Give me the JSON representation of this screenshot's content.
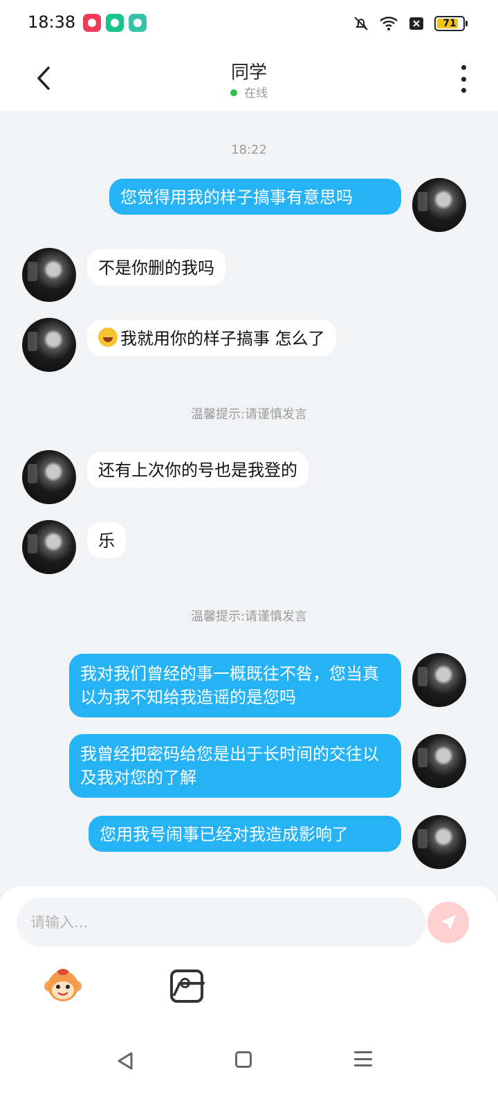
{
  "status_bar": {
    "time": "18:38",
    "battery": "71"
  },
  "header": {
    "title": "同学",
    "status": "在线"
  },
  "chat": {
    "timestamp": "18:22",
    "notice_1": "温馨提示:请谨慎发言",
    "notice_2": "温馨提示:请谨慎发言",
    "messages": [
      {
        "from": "me",
        "text": "您觉得用我的样子搞事有意思吗"
      },
      {
        "from": "friend",
        "text": "不是你删的我吗"
      },
      {
        "from": "friend",
        "text": "我就用你的样子搞事 怎么了"
      },
      {
        "from": "friend",
        "text": "还有上次你的号也是我登的"
      },
      {
        "from": "friend",
        "text": "乐"
      },
      {
        "from": "me",
        "text": "我对我们曾经的事一概既往不咎，您当真以为我不知给我造谣的是您吗"
      },
      {
        "from": "me",
        "text": "我曾经把密码给您是出于长时间的交往以及我对您的了解"
      },
      {
        "from": "me",
        "text": "您用我号闹事已经对我造成影响了"
      }
    ]
  },
  "input": {
    "placeholder": "请输入..."
  },
  "icons": {
    "back": "chevron-left-icon",
    "more": "more-vertical-icon",
    "send": "send-icon",
    "emoji_tool": "monkey-emoji-icon",
    "image_tool": "image-icon"
  },
  "colors": {
    "accent": "#26b3f5",
    "online": "#2ec24f",
    "send_bg": "#ffd0cf"
  }
}
